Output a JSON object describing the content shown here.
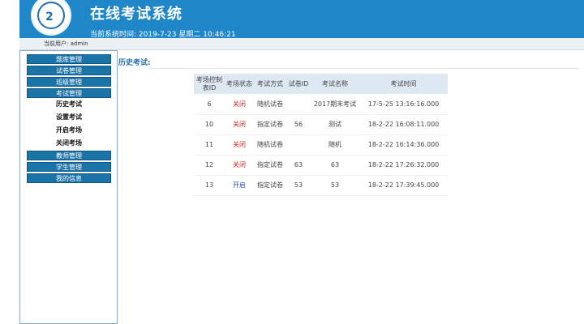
{
  "header": {
    "title": "在线考试系统",
    "time_label": "当前系统时间:",
    "time_value": "2019-7-23 星期二 10:46:21"
  },
  "userbar": {
    "label": "当前用户: admin"
  },
  "sidebar": {
    "items": [
      {
        "label": "题库管理"
      },
      {
        "label": "试卷管理"
      },
      {
        "label": "班级管理"
      },
      {
        "label": "考试管理"
      },
      {
        "label": "教师管理"
      },
      {
        "label": "学生管理"
      },
      {
        "label": "我的信息"
      }
    ],
    "subitems": [
      {
        "label": "历史考试"
      },
      {
        "label": "设置考试"
      },
      {
        "label": "开启考场"
      },
      {
        "label": "关闭考场"
      }
    ]
  },
  "main": {
    "section_title": "历史考试:",
    "table": {
      "headers": [
        "考场控制表ID",
        "考场状态",
        "考试方式",
        "试卷ID",
        "考试名称",
        "考试时间"
      ],
      "rows": [
        [
          "6",
          "关闭",
          "随机试卷",
          "",
          "2017期末考试",
          "17-5-25 13:16:16.000"
        ],
        [
          "10",
          "关闭",
          "指定试卷",
          "56",
          "测试",
          "18-2-22 16:08:11.000"
        ],
        [
          "11",
          "关闭",
          "随机试卷",
          "",
          "随机",
          "18-2-22 16:14:36.000"
        ],
        [
          "12",
          "关闭",
          "指定试卷",
          "63",
          "63",
          "18-2-22 17:26:32.000"
        ],
        [
          "13",
          "开启",
          "指定试卷",
          "53",
          "53",
          "18-2-22 17:39:45.000"
        ]
      ]
    }
  },
  "colors": {
    "brand": "#1f86c8",
    "nav": "#1b74a8",
    "closed": "#d42020",
    "open": "#1f4fc8"
  },
  "icons": {
    "logo": "school-logo-icon"
  }
}
